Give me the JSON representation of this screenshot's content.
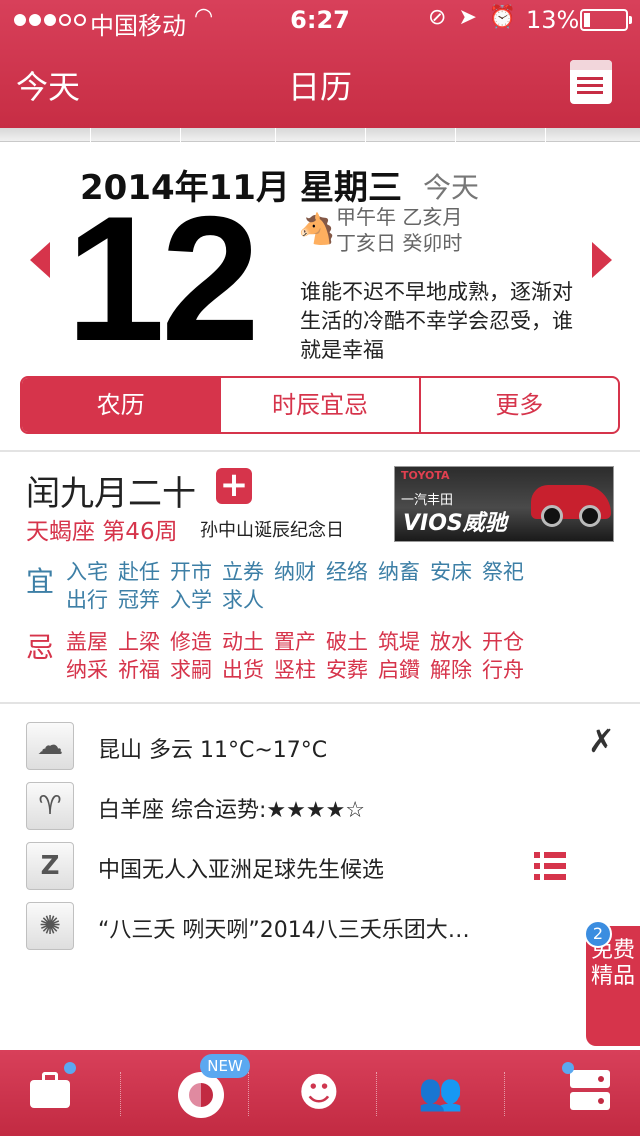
{
  "status_bar": {
    "carrier": "中国移动",
    "time": "6:27",
    "battery_pct": "13%",
    "battery_level": 0.13,
    "signal_bars": 3
  },
  "nav": {
    "left": "今天",
    "title": "日历",
    "right_icon": "calendar-notes-icon"
  },
  "date": {
    "year_month": "2014年11月",
    "weekday": "星期三",
    "today": "今天",
    "day": "12",
    "zodiac_icon": "horse-icon",
    "ganzhi_line1": "甲午年 乙亥月",
    "ganzhi_line2": "丁亥日 癸卯时",
    "quote": "谁能不迟不早地成熟，逐渐对生活的冷酷不幸学会忍受，谁就是幸福"
  },
  "tabs": [
    {
      "label": "农历",
      "active": true
    },
    {
      "label": "时辰宜忌",
      "active": false
    },
    {
      "label": "更多",
      "active": false
    }
  ],
  "lunar": {
    "day": "闰九月二十",
    "plus": "+",
    "constellation_week": "天蝎座 第46周",
    "festival": "孙中山诞辰纪念日",
    "ad": {
      "brand": "TOYOTA",
      "model": "一汽丰田",
      "name": "VIOS威驰"
    },
    "yi_label": "宜",
    "yi": [
      "入宅",
      "赴任",
      "开市",
      "立券",
      "纳财",
      "经络",
      "纳畜",
      "安床",
      "祭祀",
      "出行",
      "冠笄",
      "入学",
      "求人"
    ],
    "ji_label": "忌",
    "ji": [
      "盖屋",
      "上梁",
      "修造",
      "动土",
      "置产",
      "破土",
      "筑堤",
      "放水",
      "开仓",
      "纳采",
      "祈福",
      "求嗣",
      "出货",
      "竖柱",
      "安葬",
      "启鑽",
      "解除",
      "行舟"
    ]
  },
  "info": [
    {
      "icon": "cloud-icon",
      "text": "昆山 多云 11°C~17°C"
    },
    {
      "icon": "aries-icon",
      "text": "白羊座 综合运势:★★★★☆"
    },
    {
      "icon": "z-icon",
      "text": "中国无人入亚洲足球先生候选"
    },
    {
      "icon": "fan-icon",
      "text": "“八三夭 咧天咧”2014八三夭乐团大…"
    }
  ],
  "side_promo": {
    "badge": "2",
    "line1": "免费",
    "line2": "精品"
  },
  "tabbar": {
    "new_badge": "NEW",
    "items": [
      "toolbox-icon",
      "bagua-icon",
      "girl-icon",
      "people-icon",
      "settings-icon"
    ]
  },
  "colors": {
    "brand": "#d6344b",
    "yi": "#3d7fa6",
    "badge": "#5ba8f0"
  }
}
